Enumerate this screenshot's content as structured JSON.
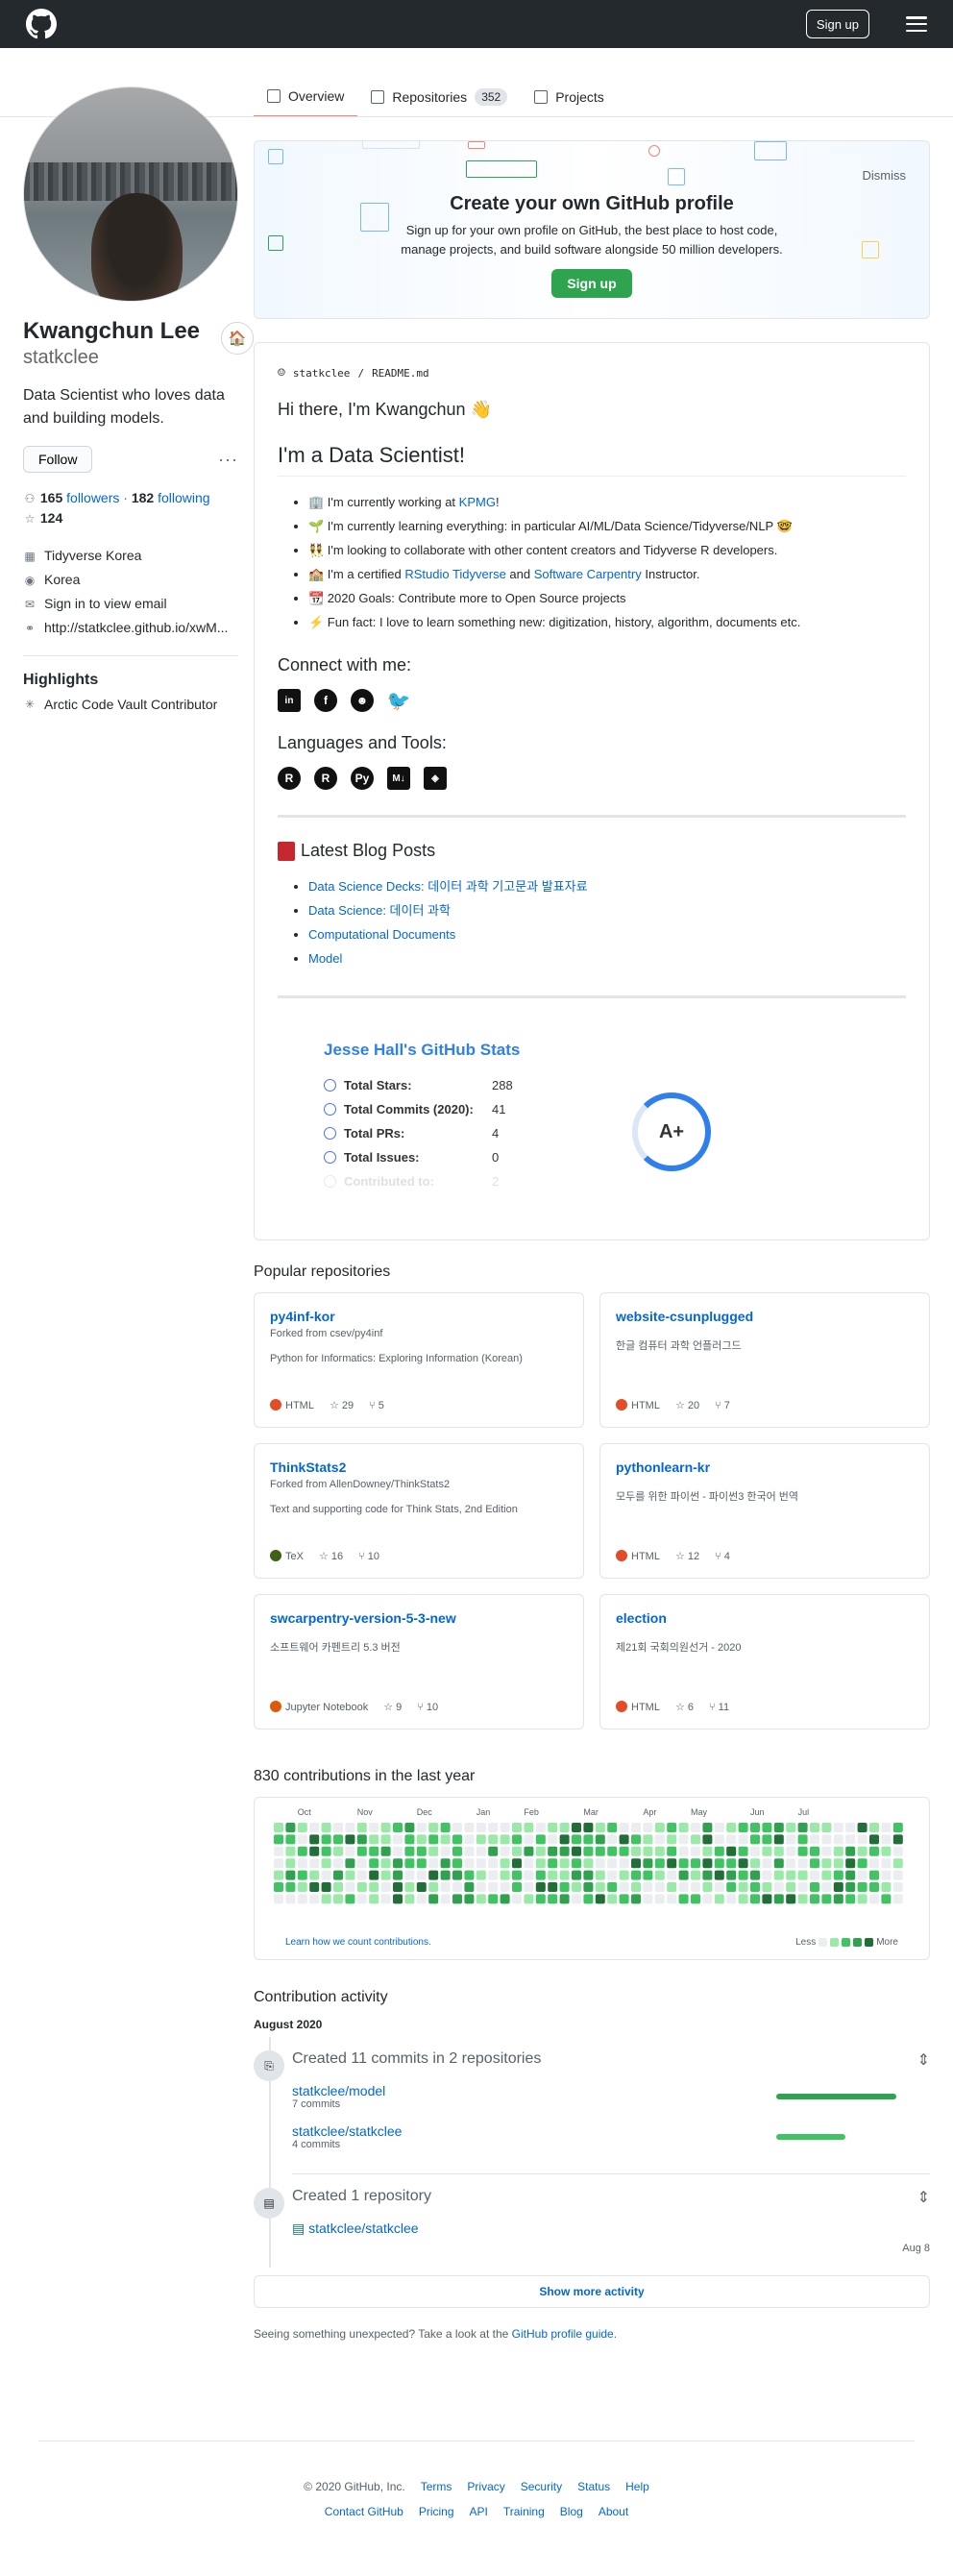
{
  "header": {
    "signup_label": "Sign up"
  },
  "tabs": [
    {
      "label": "Overview"
    },
    {
      "label": "Repositories",
      "count": "352"
    },
    {
      "label": "Projects"
    }
  ],
  "profile": {
    "fullname": "Kwangchun Lee",
    "username": "statkclee",
    "bio": "Data Scientist who loves data and building models.",
    "follow_label": "Follow",
    "followers": "165",
    "followers_label": "followers",
    "following": "182",
    "following_label": "following",
    "stars": "124",
    "org": "Tidyverse Korea",
    "location": "Korea",
    "email": "Sign in to view email",
    "website": "http://statkclee.github.io/xwM...",
    "highlights_title": "Highlights",
    "highlight_item": "Arctic Code Vault Contributor"
  },
  "banner": {
    "title": "Create your own GitHub profile",
    "text": "Sign up for your own profile on GitHub, the best place to host code, manage projects, and build software alongside 50 million developers.",
    "button": "Sign up",
    "dismiss": "Dismiss"
  },
  "readme": {
    "path_user": "statkclee",
    "path_sep": "/",
    "path_file": "README.md",
    "greeting": "Hi there, I'm Kwangchun 👋",
    "heading": "I'm a Data Scientist!",
    "items": [
      {
        "pre": "🏢 I'm currently working at ",
        "link": "KPMG",
        "post": "!"
      },
      {
        "pre": "🌱 I'm currently learning everything: in particular AI/ML/Data Science/Tidyverse/NLP 🤓",
        "link": "",
        "post": ""
      },
      {
        "pre": "👯 I'm looking to collaborate with other content creators and Tidyverse R developers.",
        "link": "",
        "post": ""
      },
      {
        "pre": "🏫 I'm a certified ",
        "link": "RStudio Tidyverse",
        "mid": " and ",
        "link2": "Software Carpentry",
        "post": " Instructor."
      },
      {
        "pre": "📆 2020 Goals: Contribute more to Open Source projects",
        "link": "",
        "post": ""
      },
      {
        "pre": "⚡ Fun fact: I love to learn something new: digitization, history, algorithm, documents etc.",
        "link": "",
        "post": ""
      }
    ],
    "connect_title": "Connect with me:",
    "tools_title": "Languages and Tools:",
    "blog_title": "Latest Blog Posts",
    "blog_posts": [
      "Data Science Decks: 데이터 과학 기고문과 발표자료",
      "Data Science: 데이터 과학",
      "Computational Documents",
      "Model"
    ]
  },
  "stats_card": {
    "title": "Jesse Hall's GitHub Stats",
    "rows": [
      {
        "label": "Total Stars:",
        "value": "288"
      },
      {
        "label": "Total Commits (2020):",
        "value": "41"
      },
      {
        "label": "Total PRs:",
        "value": "4"
      },
      {
        "label": "Total Issues:",
        "value": "0"
      },
      {
        "label": "Contributed to:",
        "value": "2"
      }
    ],
    "grade": "A+"
  },
  "popular": {
    "title": "Popular repositories",
    "repos": [
      {
        "name": "py4inf-kor",
        "fork": "Forked from csev/py4inf",
        "desc": "Python for Informatics: Exploring Information (Korean)",
        "lang": "HTML",
        "lang_color": "#e34c26",
        "stars": "29",
        "forks": "5"
      },
      {
        "name": "website-csunplugged",
        "fork": "",
        "desc": "한글 컴퓨터 과학 언플러그드",
        "lang": "HTML",
        "lang_color": "#e34c26",
        "stars": "20",
        "forks": "7"
      },
      {
        "name": "ThinkStats2",
        "fork": "Forked from AllenDowney/ThinkStats2",
        "desc": "Text and supporting code for Think Stats, 2nd Edition",
        "lang": "TeX",
        "lang_color": "#3D6117",
        "stars": "16",
        "forks": "10"
      },
      {
        "name": "pythonlearn-kr",
        "fork": "",
        "desc": "모두를 위한 파이썬 - 파이썬3 한국어 번역",
        "lang": "HTML",
        "lang_color": "#e34c26",
        "stars": "12",
        "forks": "4"
      },
      {
        "name": "swcarpentry-version-5-3-new",
        "fork": "",
        "desc": "소프트웨어 카펜트리 5.3 버전",
        "lang": "Jupyter Notebook",
        "lang_color": "#DA5B0B",
        "stars": "9",
        "forks": "10"
      },
      {
        "name": "election",
        "fork": "",
        "desc": "제21회 국회의원선거 - 2020",
        "lang": "HTML",
        "lang_color": "#e34c26",
        "stars": "6",
        "forks": "11"
      }
    ]
  },
  "contributions": {
    "title": "830 contributions in the last year",
    "months": [
      "Oct",
      "Nov",
      "Dec",
      "Jan",
      "Feb",
      "Mar",
      "Apr",
      "May",
      "Jun",
      "Jul"
    ],
    "learn": "Learn how we count contributions.",
    "less": "Less",
    "more": "More",
    "colors": [
      "#ebedf0",
      "#9be9a8",
      "#40c463",
      "#30a14e",
      "#216e39"
    ]
  },
  "activity": {
    "title": "Contribution activity",
    "month": "August 2020",
    "commits_heading": "Created 11 commits in 2 repositories",
    "commit_repos": [
      {
        "name": "statkclee/model",
        "count": "7 commits",
        "bar": 0.78
      },
      {
        "name": "statkclee/statkclee",
        "count": "4 commits",
        "bar": 0.45
      }
    ],
    "repo_heading": "Created 1 repository",
    "created_repo": "statkclee/statkclee",
    "created_date": "Aug 8",
    "show_more": "Show more activity",
    "unexpected_pre": "Seeing something unexpected? Take a look at the ",
    "unexpected_link": "GitHub profile guide",
    "unexpected_post": "."
  },
  "footer": {
    "copyright": "© 2020 GitHub, Inc.",
    "row1": [
      "Terms",
      "Privacy",
      "Security",
      "Status",
      "Help"
    ],
    "row2": [
      "Contact GitHub",
      "Pricing",
      "API",
      "Training",
      "Blog",
      "About"
    ]
  }
}
